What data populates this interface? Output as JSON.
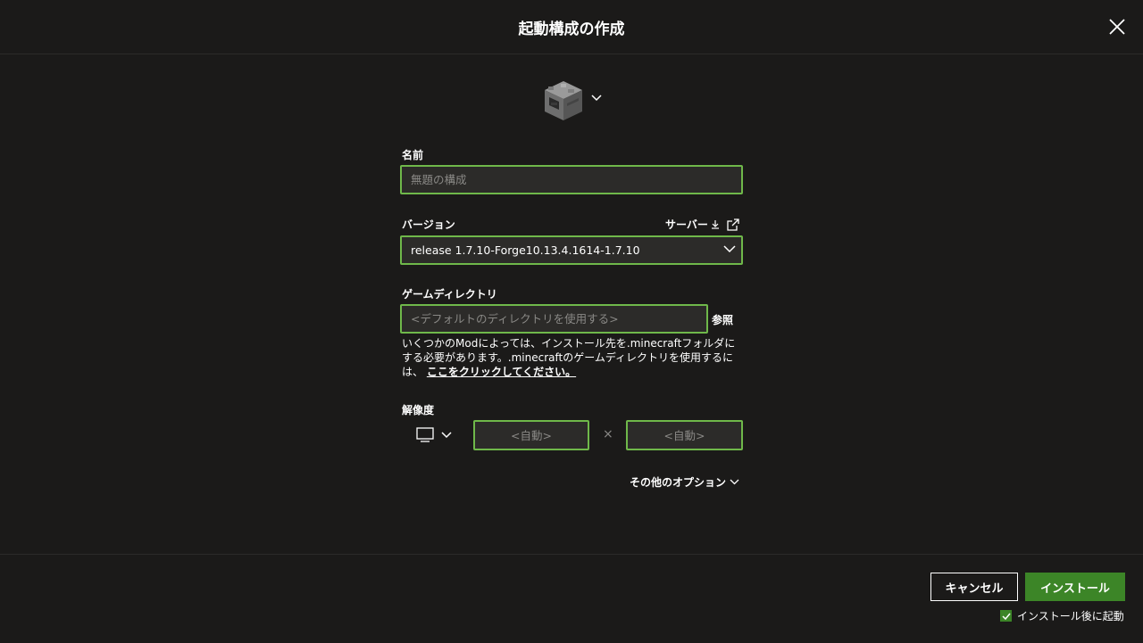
{
  "header": {
    "title": "起動構成の作成"
  },
  "icon": {
    "name": "furnace-icon"
  },
  "name_field": {
    "label": "名前",
    "placeholder": "無題の構成",
    "value": ""
  },
  "version": {
    "label": "バージョン",
    "server_link": "サーバー",
    "selected": "release 1.7.10-Forge10.13.4.1614-1.7.10"
  },
  "game_dir": {
    "label": "ゲームディレクトリ",
    "placeholder": "<デフォルトのディレクトリを使用する>",
    "value": "",
    "browse": "参照",
    "help_text": "いくつかのModによっては、インストール先を.minecraftフォルダにする必要があります。.minecraftのゲームディレクトリを使用するには、",
    "help_link": "ここをクリックしてください。"
  },
  "resolution": {
    "label": "解像度",
    "width_placeholder": "<自動>",
    "height_placeholder": "<自動>",
    "separator": "×"
  },
  "more_options": "その他のオプション",
  "footer": {
    "cancel": "キャンセル",
    "install": "インストール",
    "launch_after": "インストール後に起動",
    "launch_checked": true
  },
  "colors": {
    "accent": "#6fb84a",
    "primary_button": "#3c8527",
    "background": "#1b1a19",
    "field_bg": "#2c2b29"
  }
}
